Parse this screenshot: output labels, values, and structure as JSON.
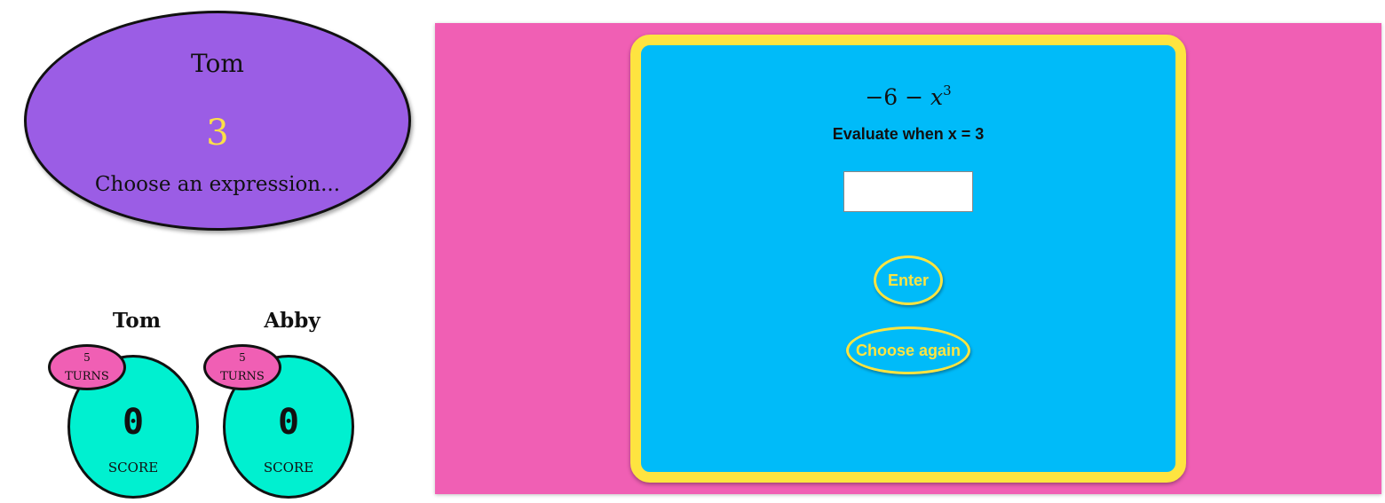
{
  "current_turn": {
    "player_name": "Tom",
    "value": "3",
    "prompt": "Choose an expression..."
  },
  "players": [
    {
      "name": "Tom",
      "turns": "5",
      "turns_label": "TURNS",
      "score": "0",
      "score_label": "SCORE"
    },
    {
      "name": "Abby",
      "turns": "5",
      "turns_label": "TURNS",
      "score": "0",
      "score_label": "SCORE"
    }
  ],
  "question": {
    "expression_prefix": "−6 − ",
    "expression_variable": "x",
    "expression_exponent": "3",
    "instruction": "Evaluate when x = 3",
    "answer_value": ""
  },
  "buttons": {
    "enter_label": "Enter",
    "choose_again_label": "Choose again"
  },
  "colors": {
    "current_panel": "#9b5de5",
    "board": "#f05fb4",
    "card": "#00bbf9",
    "card_border": "#fee440",
    "score_oval": "#00f0d0",
    "turns_oval": "#f05fb4"
  }
}
